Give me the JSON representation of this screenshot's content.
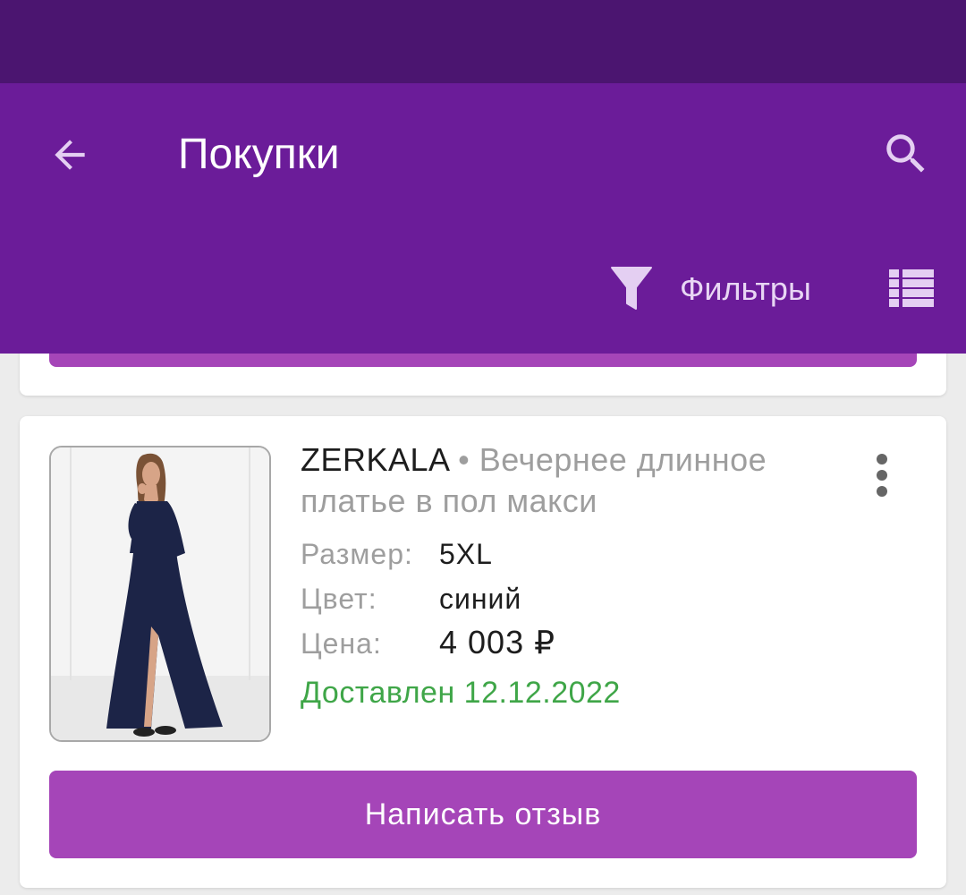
{
  "header": {
    "title": "Покупки",
    "filter_label": "Фильтры"
  },
  "icons": {
    "back": "arrow-left-icon",
    "search": "search-icon",
    "filter": "funnel-icon",
    "list_view": "list-view-icon",
    "more": "more-vertical-icon"
  },
  "colors": {
    "status_bar": "#4b1570",
    "app_bar": "#6b1c99",
    "accent_button": "#a545b8",
    "delivered": "#3fa648"
  },
  "order": {
    "brand": "ZERKALA",
    "separator": "•",
    "product_name": "Вечернее длинное платье в пол макси",
    "size_label": "Размер:",
    "size_value": "5XL",
    "color_label": "Цвет:",
    "color_value": "синий",
    "price_label": "Цена:",
    "price_value": "4 003 ₽",
    "status": "Доставлен 12.12.2022",
    "review_button": "Написать отзыв"
  }
}
